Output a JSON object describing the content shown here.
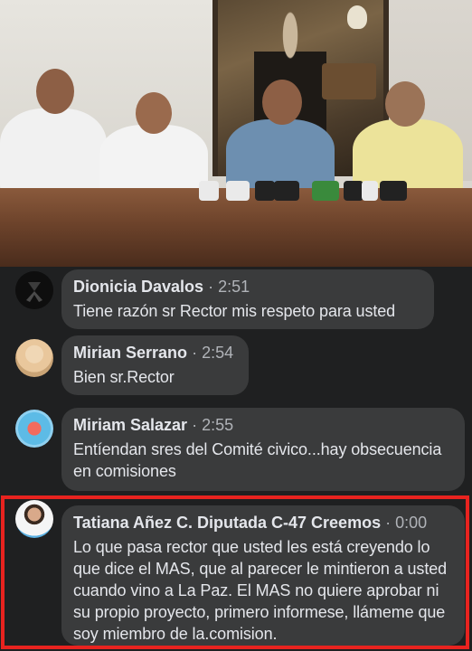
{
  "video": {
    "description_icon": "press-conference-video-frame"
  },
  "comments": [
    {
      "author": "Dionicia Davalos",
      "time": "2:51",
      "text": "Tiene razón sr Rector  mis respeto para usted",
      "avatar_icon": "black-ribbon-icon"
    },
    {
      "author": "Mirian Serrano",
      "time": "2:54",
      "text": "Bien sr.Rector",
      "avatar_icon": "profile-photo-icon"
    },
    {
      "author": "Miriam Salazar",
      "time": "2:55",
      "text": "Entíendan sres del Comité civico...hay obsecuencia en comisiones",
      "avatar_icon": "profile-photo-icon"
    },
    {
      "author": "Tatiana Añez C. Diputada C-47 Creemos",
      "time": "0:00",
      "text": "Lo que pasa rector que usted les está creyendo lo que dice el MAS, que al parecer le mintieron a usted cuando vino a La Paz. El MAS no quiere aprobar ni su propio proyecto, primero informese, llámeme que soy miembro de la.comision.",
      "avatar_icon": "profile-photo-icon"
    }
  ],
  "separator": "·",
  "colors": {
    "background": "#1f2021",
    "bubble": "#3a3b3c",
    "highlight": "#e8231f",
    "author_text": "#e4e6eb",
    "meta_text": "#b0b3b8"
  }
}
